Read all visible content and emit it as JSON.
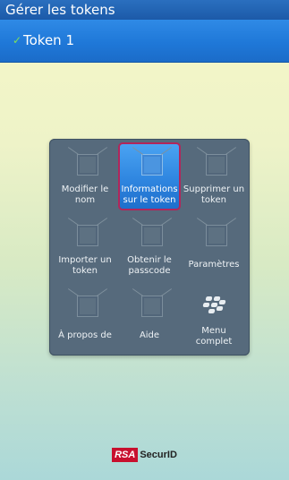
{
  "header": {
    "title": "Gérer les tokens"
  },
  "token": {
    "check_icon": "check-icon",
    "name": "Token 1"
  },
  "menu": {
    "items": [
      {
        "label": "Modifier le nom",
        "icon": "generic-square-icon",
        "selected": false
      },
      {
        "label": "Informations sur le token",
        "icon": "generic-square-icon",
        "selected": true
      },
      {
        "label": "Supprimer un token",
        "icon": "generic-square-icon",
        "selected": false
      },
      {
        "label": "Importer un token",
        "icon": "generic-square-icon",
        "selected": false
      },
      {
        "label": "Obtenir le passcode",
        "icon": "generic-square-icon",
        "selected": false
      },
      {
        "label": "Paramètres",
        "icon": "generic-square-icon",
        "selected": false
      },
      {
        "label": "À propos de",
        "icon": "generic-square-icon",
        "selected": false
      },
      {
        "label": "Aide",
        "icon": "generic-square-icon",
        "selected": false
      },
      {
        "label": "Menu complet",
        "icon": "blackberry-icon",
        "selected": false
      }
    ]
  },
  "footer": {
    "brand_rsa": "RSA",
    "brand_product": "SecurID"
  },
  "colors": {
    "header_bg": "#1c5aa8",
    "token_bar_bg": "#1f78d8",
    "menu_bg": "#566a7c",
    "selection_border": "#b2265a",
    "rsa_red": "#c8102e"
  }
}
